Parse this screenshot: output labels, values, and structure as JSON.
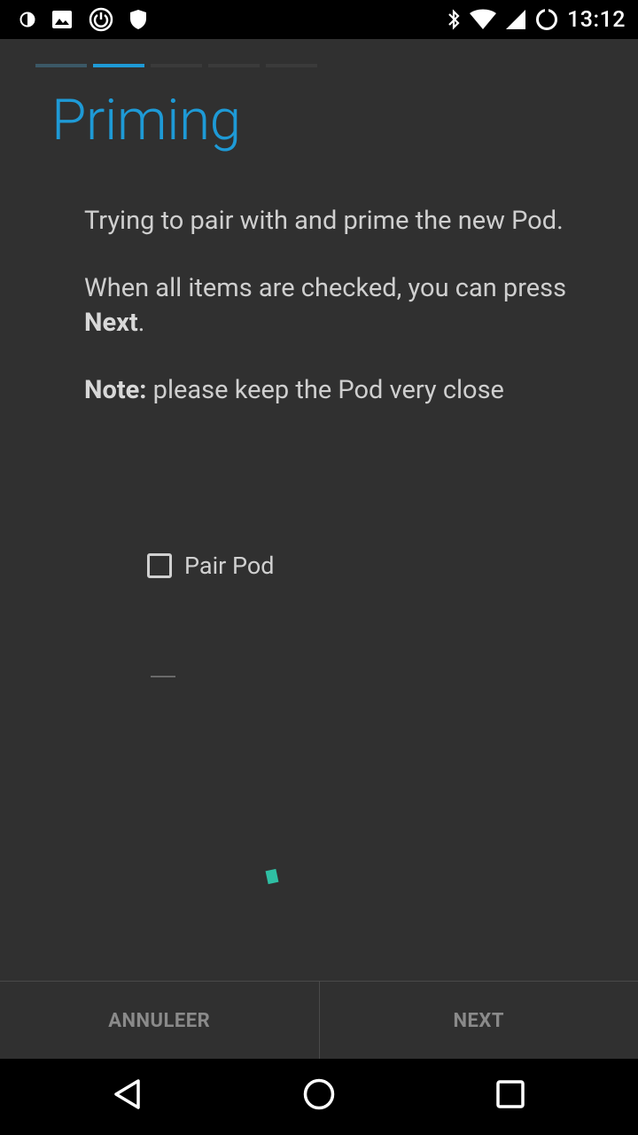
{
  "status_bar": {
    "time": "13:12",
    "left_icons": [
      "half-circle-icon",
      "image-icon",
      "power-icon",
      "shield-icon"
    ],
    "right_icons": [
      "bluetooth-icon",
      "wifi-icon",
      "signal-icon",
      "sync-icon"
    ]
  },
  "wizard": {
    "title": "Priming",
    "steps_total": 5,
    "current_step": 2,
    "paragraph1": "Trying to pair with and prime the new Pod.",
    "paragraph2_prefix": "When all items are checked, you can press ",
    "paragraph2_bold": "Next",
    "paragraph2_suffix": ".",
    "note_bold": "Note:",
    "note_text": " please keep the Pod very close"
  },
  "checklist": {
    "items": [
      {
        "label": "Pair Pod",
        "checked": false
      }
    ]
  },
  "footer": {
    "cancel_label": "ANNULEER",
    "next_label": "NEXT"
  },
  "colors": {
    "accent": "#1e9ad6",
    "background": "#303030",
    "spinner": "#2fbfa4"
  }
}
